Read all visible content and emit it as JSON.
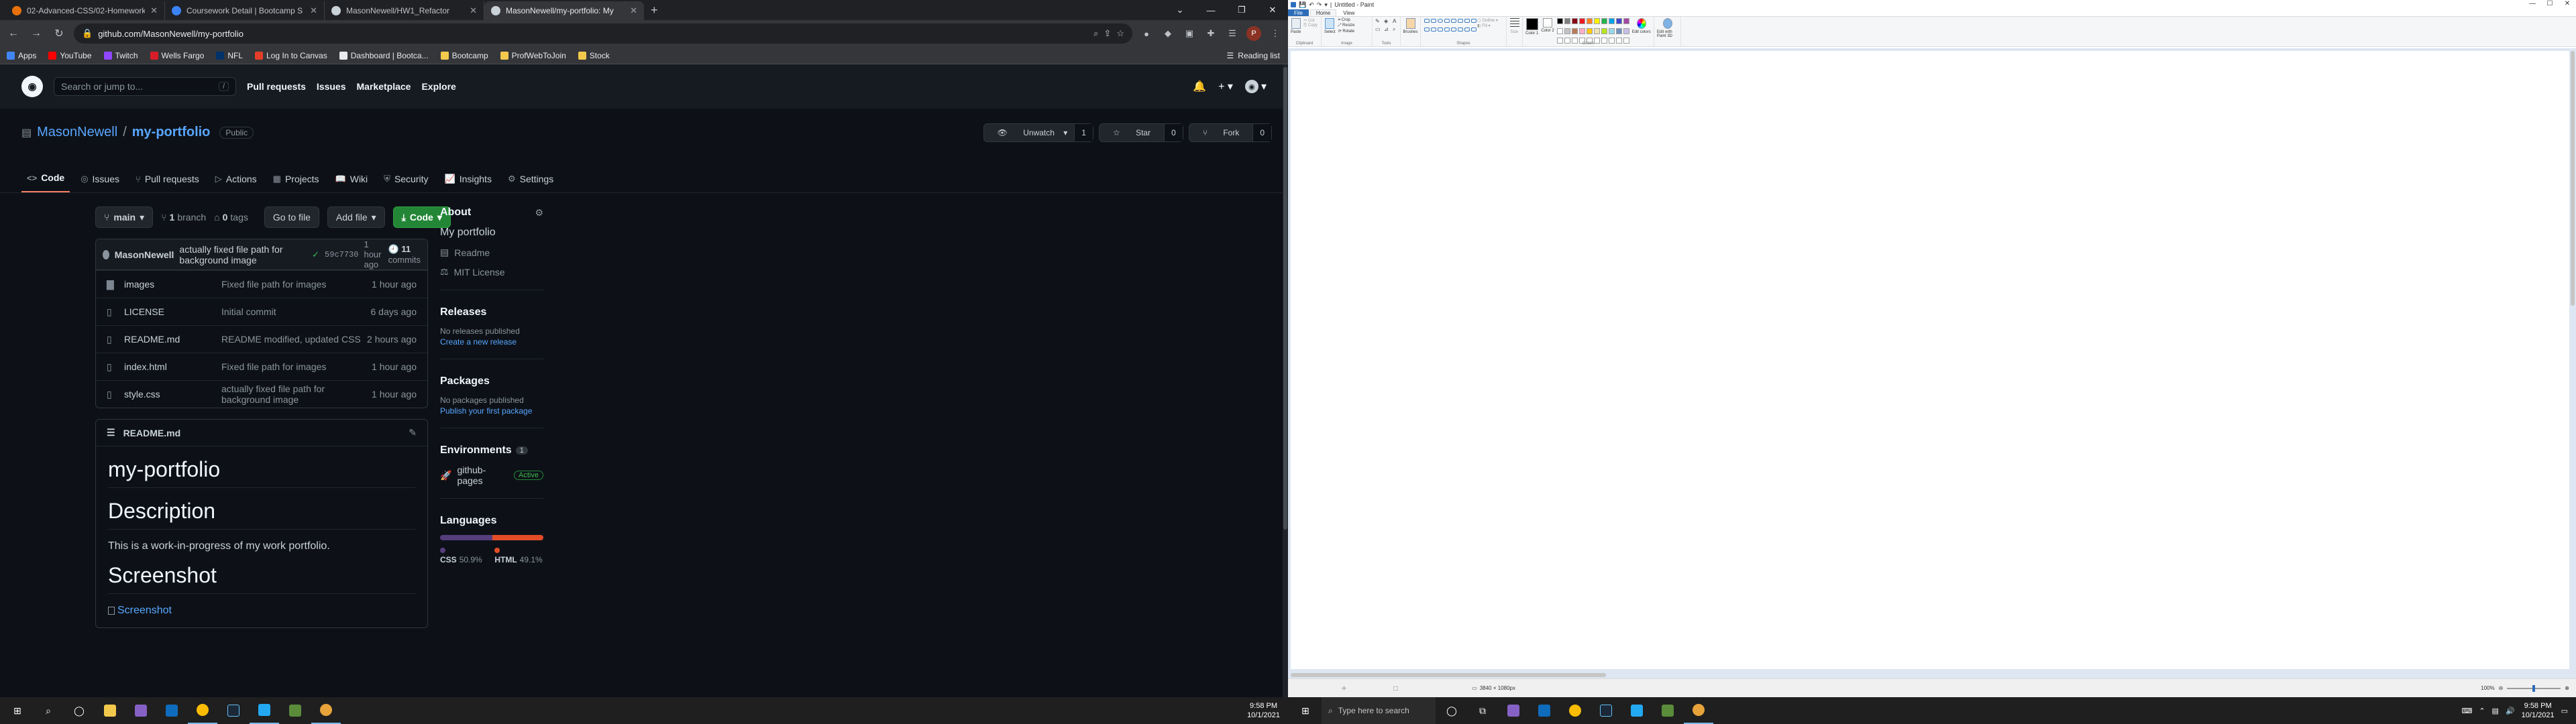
{
  "browser": {
    "tabs": [
      {
        "title": "02-Advanced-CSS/02-Homework",
        "color": "#e8710a"
      },
      {
        "title": "Coursework Detail | Bootcamp S",
        "color": "#3b82f6"
      },
      {
        "title": "MasonNewell/HW1_Refactor",
        "color": "#c9d1d9"
      },
      {
        "title": "MasonNewell/my-portfolio: My",
        "color": "#c9d1d9"
      }
    ],
    "url": "github.com/MasonNewell/my-portfolio",
    "profile_initial": "P",
    "bookmarks": [
      {
        "label": "Apps",
        "color": "#4285f4"
      },
      {
        "label": "YouTube",
        "color": "#ff0000"
      },
      {
        "label": "Twitch",
        "color": "#9146ff"
      },
      {
        "label": "Wells Fargo",
        "color": "#d71e28"
      },
      {
        "label": "NFL",
        "color": "#013369"
      },
      {
        "label": "Log In to Canvas",
        "color": "#e13f2a"
      },
      {
        "label": "Dashboard | Bootca...",
        "color": "#e8eaed"
      },
      {
        "label": "Bootcamp",
        "color": "#f2c94c"
      },
      {
        "label": "ProfWebToJoin",
        "color": "#f2c94c"
      },
      {
        "label": "Stock",
        "color": "#f2c94c"
      }
    ],
    "reading_list": "Reading list"
  },
  "github": {
    "search_placeholder": "Search or jump to...",
    "slash": "/",
    "nav": [
      "Pull requests",
      "Issues",
      "Marketplace",
      "Explore"
    ],
    "owner": "MasonNewell",
    "separator": "/",
    "repo": "my-portfolio",
    "visibility": "Public",
    "actions": {
      "watch": "Unwatch",
      "watch_count": "1",
      "star": "Star",
      "star_count": "0",
      "fork": "Fork",
      "fork_count": "0"
    },
    "tabs": [
      {
        "label": "Code",
        "icon": "<>"
      },
      {
        "label": "Issues",
        "icon": "◎"
      },
      {
        "label": "Pull requests",
        "icon": "⑂"
      },
      {
        "label": "Actions",
        "icon": "▷"
      },
      {
        "label": "Projects",
        "icon": "▦"
      },
      {
        "label": "Wiki",
        "icon": "📖"
      },
      {
        "label": "Security",
        "icon": "⛨"
      },
      {
        "label": "Insights",
        "icon": "📈"
      },
      {
        "label": "Settings",
        "icon": "⚙"
      }
    ],
    "branch": "main",
    "branches_count": "1",
    "branches_label": "branch",
    "tags_count": "0",
    "tags_label": "tags",
    "go_to_file": "Go to file",
    "add_file": "Add file",
    "code_button": "Code",
    "last_commit": {
      "user": "MasonNewell",
      "message": "actually fixed file path for background image",
      "sha": "59c7730",
      "age": "1 hour ago",
      "commit_count": "11",
      "commits_label": "commits"
    },
    "files": [
      {
        "name": "images",
        "type": "dir",
        "message": "Fixed file path for images",
        "age": "1 hour ago"
      },
      {
        "name": "LICENSE",
        "type": "file",
        "message": "Initial commit",
        "age": "6 days ago"
      },
      {
        "name": "README.md",
        "type": "file",
        "message": "README modified, updated CSS",
        "age": "2 hours ago"
      },
      {
        "name": "index.html",
        "type": "file",
        "message": "Fixed file path for images",
        "age": "1 hour ago"
      },
      {
        "name": "style.css",
        "type": "file",
        "message": "actually fixed file path for background image",
        "age": "1 hour ago"
      }
    ],
    "readme": {
      "filename": "README.md",
      "h1": "my-portfolio",
      "h2_description": "Description",
      "description": "This is a work-in-progress of my work portfolio.",
      "h2_screenshot": "Screenshot",
      "image_alt": "Screenshot"
    },
    "about": {
      "title": "About",
      "description": "My portfolio",
      "readme": "Readme",
      "license": "MIT License"
    },
    "releases": {
      "title": "Releases",
      "none": "No releases published",
      "link": "Create a new release"
    },
    "packages": {
      "title": "Packages",
      "none": "No packages published",
      "link": "Publish your first package"
    },
    "environments": {
      "title": "Environments",
      "count": "1",
      "name": "github-pages",
      "status": "Active"
    },
    "languages": {
      "title": "Languages",
      "items": [
        {
          "name": "CSS",
          "percent": "50.9%",
          "value": 50.9,
          "color": "#563d7c"
        },
        {
          "name": "HTML",
          "percent": "49.1%",
          "value": 49.1,
          "color": "#e34c26"
        }
      ]
    }
  },
  "taskbar": {
    "search_placeholder": "Type here to search",
    "time": "9:58 PM",
    "date": "10/1/2021"
  },
  "paint": {
    "title": "Untitled - Paint",
    "tabs": [
      "File",
      "Home",
      "View"
    ],
    "clipboard": {
      "paste": "Paste",
      "cut": "Cut",
      "copy": "Copy",
      "label": "Clipboard"
    },
    "image": {
      "select": "Select",
      "crop": "Crop",
      "resize": "Resize",
      "rotate": "Rotate",
      "label": "Image"
    },
    "tools": {
      "label": "Tools"
    },
    "brushes": "Brushes",
    "shapes": {
      "label": "Shapes",
      "outline": "Outline",
      "fill": "Fill"
    },
    "size": "Size",
    "color1": "Color 1",
    "color2": "Color 2",
    "colors_label": "Colors",
    "edit_colors": "Edit colors",
    "edit_paint3d": "Edit with Paint 3D",
    "palette": [
      "#000000",
      "#7f7f7f",
      "#880015",
      "#ed1c24",
      "#ff7f27",
      "#fff200",
      "#22b14c",
      "#00a2e8",
      "#3f48cc",
      "#a349a4",
      "#ffffff",
      "#c3c3c3",
      "#b97a57",
      "#ffaec9",
      "#ffc90e",
      "#efe4b0",
      "#b5e61d",
      "#99d9ea",
      "#7092be",
      "#c8bfe7"
    ],
    "dimensions": "3840 × 1080px",
    "zoom": "100%"
  }
}
